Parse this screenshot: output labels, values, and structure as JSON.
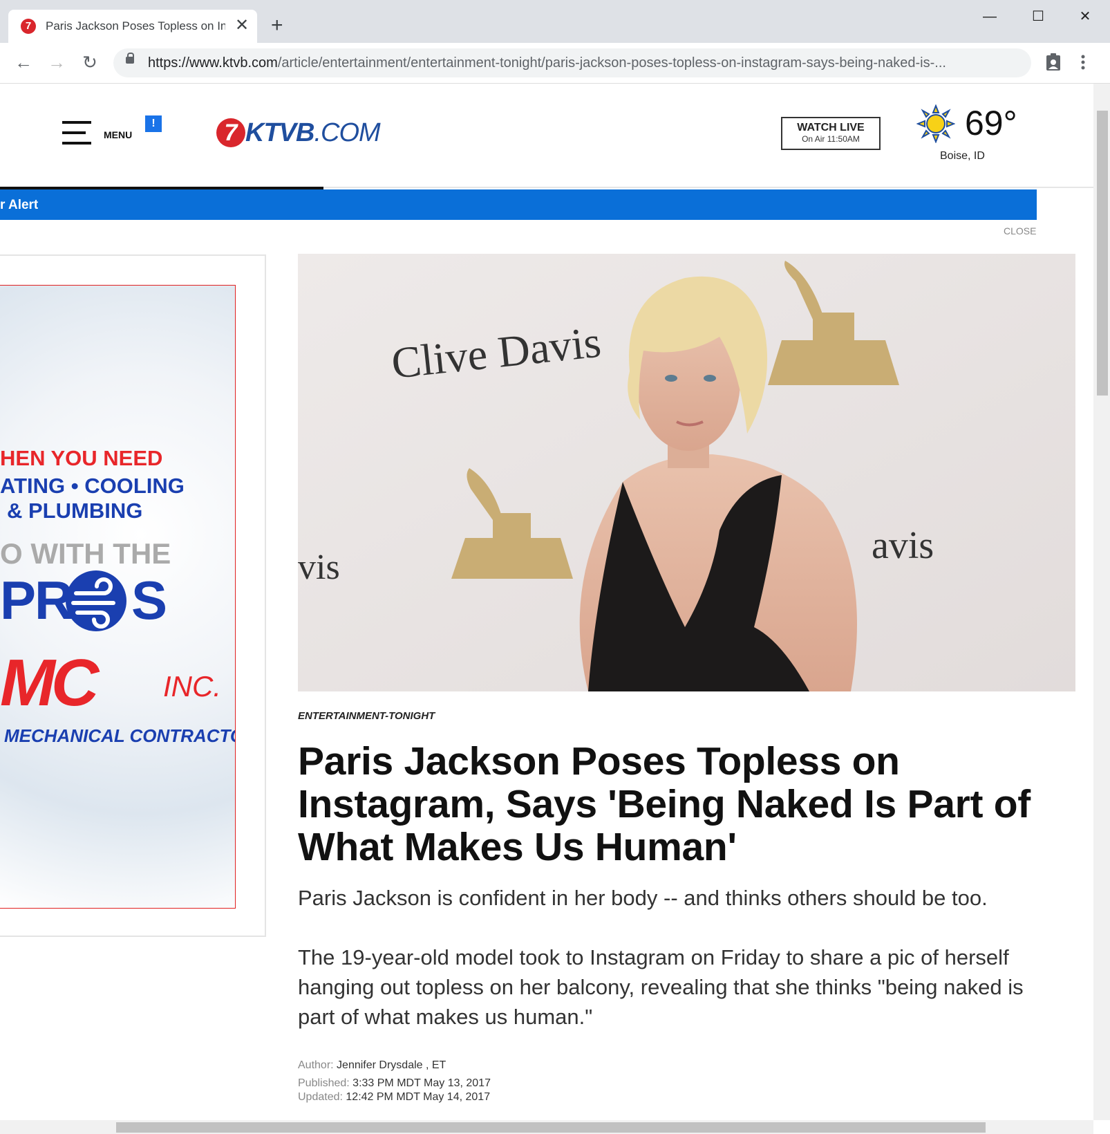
{
  "browser": {
    "tab_title": "Paris Jackson Poses Topless on Instagram",
    "favicon_text": "7",
    "new_tab": "+",
    "url_host": "https://www.ktvb.com",
    "url_path": "/article/entertainment/entertainment-tonight/paris-jackson-poses-topless-on-instagram-says-being-naked-is-...",
    "window": {
      "minimize": "—",
      "maximize": "☐",
      "close": "✕"
    }
  },
  "site": {
    "menu_label": "MENU",
    "menu_badge": "!",
    "logo_seven": "7",
    "logo_bold": "KTVB",
    "logo_rest": ".COM",
    "watch_live": "WATCH LIVE",
    "on_air": "On Air 11:50AM",
    "temperature": "69°",
    "city": "Boise, ID",
    "alert_text": "r Alert",
    "close_label": "CLOSE",
    "colors": {
      "brand_blue": "#1f4e9e",
      "alert_blue": "#0a6fd8",
      "brand_red": "#d9262c"
    }
  },
  "ad": {
    "lines": [
      "HEN YOU NEED",
      "ATING • COOLING",
      "& PLUMBING",
      "O WITH THE",
      "PR",
      "S",
      "MC",
      "INC.",
      "MECHANICAL CONTRACTOR"
    ]
  },
  "hero_image": {
    "backdrop_text_1": "Clive Davis",
    "backdrop_text_2": "vis",
    "backdrop_text_3": "avis"
  },
  "article": {
    "category": "ENTERTAINMENT-TONIGHT",
    "headline": "Paris Jackson Poses Topless on Instagram, Says 'Being Naked Is Part of What Makes Us Human'",
    "paragraphs": [
      "Paris Jackson is confident in her body -- and thinks others should be too.",
      "The 19-year-old model took to Instagram on Friday to share a pic of herself hanging out topless on her balcony, revealing that she thinks \"being naked is part of what makes us human.\""
    ],
    "author_label": "Author:",
    "author": "Jennifer Drysdale , ET",
    "published_label": "Published:",
    "published": "3:33 PM MDT May 13, 2017",
    "updated_label": "Updated:",
    "updated": "12:42 PM MDT May 14, 2017"
  }
}
